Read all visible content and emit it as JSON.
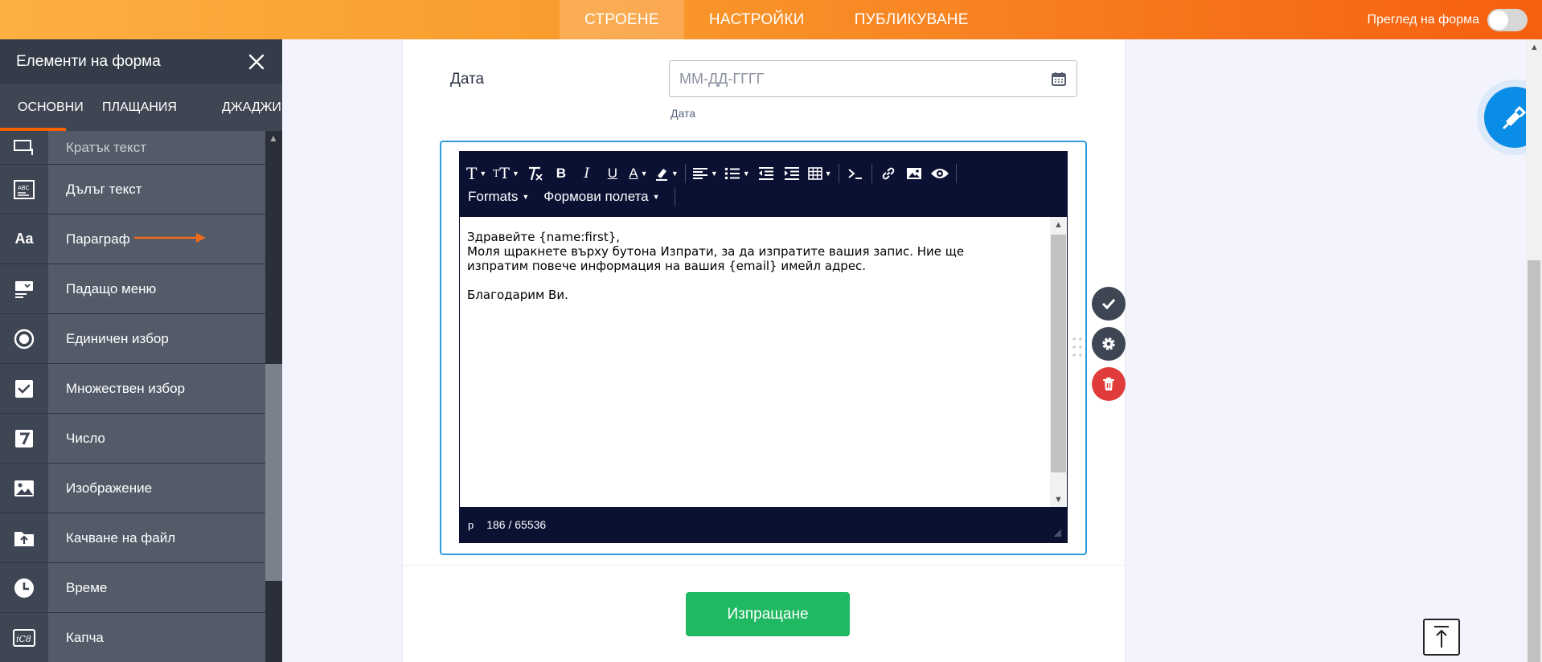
{
  "topbar": {
    "tabs": [
      {
        "label": "СТРОЕНЕ",
        "active": true
      },
      {
        "label": "НАСТРОЙКИ",
        "active": false
      },
      {
        "label": "ПУБЛИКУВАНЕ",
        "active": false
      }
    ],
    "preview_label": "Преглед на форма",
    "preview_on": false
  },
  "sidebar": {
    "title": "Елементи на форма",
    "tabs": [
      "ОСНОВНИ",
      "ПЛАЩАНИЯ",
      "ДЖАДЖИ"
    ],
    "items": [
      {
        "label": "Кратък текст",
        "icon": "short-text-icon"
      },
      {
        "label": "Дълъг текст",
        "icon": "long-text-icon"
      },
      {
        "label": "Параграф",
        "icon": "paragraph-icon"
      },
      {
        "label": "Падащо меню",
        "icon": "dropdown-icon"
      },
      {
        "label": "Единичен избор",
        "icon": "radio-icon"
      },
      {
        "label": "Множествен избор",
        "icon": "checkbox-icon"
      },
      {
        "label": "Число",
        "icon": "number-icon"
      },
      {
        "label": "Изображение",
        "icon": "image-icon"
      },
      {
        "label": "Качване на файл",
        "icon": "file-upload-icon"
      },
      {
        "label": "Време",
        "icon": "clock-icon"
      },
      {
        "label": "Капча",
        "icon": "captcha-icon"
      }
    ]
  },
  "form": {
    "date_label": "Дата",
    "date_placeholder": "ММ-ДД-ГГГГ",
    "date_sublabel": "Дата",
    "editor": {
      "toolbar_row2": [
        "Formats",
        "Формови полета"
      ],
      "lines": [
        "Здравейте {name:first},",
        "Моля щракнете върху бутона Изпрати, за да изпратите вашия запис. Ние ще",
        "изпратим повече информация на вашия {email} имейл адрес.",
        "Благодарим Ви."
      ],
      "status_path": "p",
      "char_count": "186 / 65536"
    },
    "submit_label": "Изпращане"
  },
  "colors": {
    "accent": "#ff6100",
    "submit": "#1fb961",
    "selection_border": "#2e9bdc",
    "toolbar": "#0b1133"
  }
}
